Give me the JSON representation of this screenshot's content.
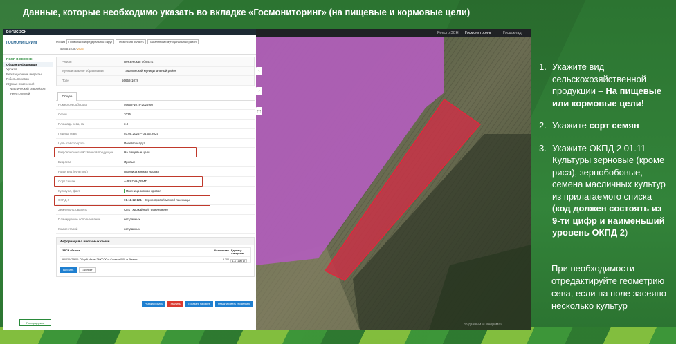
{
  "headline": "Данные, которые необходимо указать во вкладке «Госмониторинг» (на пищевые и кормовые цели)",
  "app": {
    "topbar_title": "ЕФГИС ЗСН",
    "logo": "ГОСМОНИТОРИНГ",
    "crumbs_line1": {
      "country": "Россия",
      "district": "Приволжский федеральный округ",
      "region": "Пензенская область",
      "municipality": "Тамалинский муниципальный район"
    },
    "crumbs_line2": {
      "field": "56658-1078",
      "separator": "/",
      "year": "2025"
    },
    "sidebar": {
      "section": "ПОЛЯ В СЕЗОНЕ",
      "items": [
        "Общая информация",
        "Урожай",
        "Вегетационные индексы",
        "Гибель посевов",
        "Журнал изменений",
        "Фактический севооборот",
        "Реестр полей"
      ],
      "bottom_button": "Господдержка"
    },
    "region_panel": [
      {
        "k": "Регион",
        "v": "Пензенская область"
      },
      {
        "k": "Муниципальное образование",
        "v": "Тамалинский муниципальный район"
      },
      {
        "k": "Поле",
        "v": "56658-1078"
      }
    ],
    "tab": "Общее",
    "fields": [
      {
        "k": "Номер севооборота",
        "v": "56658-1078-2025-60"
      },
      {
        "k": "Сезон",
        "v": "2025"
      },
      {
        "k": "Площадь сева, га",
        "v": "3.9"
      },
      {
        "k": "Период сева",
        "v": "03.05.2025 – 04.05.2025"
      },
      {
        "k": "Цель севооборота",
        "v": "Посев/посадка"
      },
      {
        "k": "Вид сельскохозяйственной продукции",
        "v": "На пищевые цели"
      },
      {
        "k": "Вид сева",
        "v": "Яровые"
      },
      {
        "k": "Род и вид (культура)",
        "v": "Пшеница мягкая яровая"
      },
      {
        "k": "Сорт семян",
        "v": "АЛЕКСАНДРИТ"
      },
      {
        "k": "Культура, факт",
        "v": "Пшеница мягкая яровая"
      },
      {
        "k": "ОКПД 2",
        "v": "01.11.12.121 - Зерно яровой мягкой пшеницы"
      },
      {
        "k": "Землепользователь",
        "v": "СПК \"Урожайный\" 9999999990"
      },
      {
        "k": "Планируемое использование",
        "v": "нет данных"
      },
      {
        "k": "Комментарий",
        "v": "нет данных"
      }
    ],
    "inventory": {
      "title": "Информация о вносимых семян",
      "col1": "ЭВСИ объекта",
      "col2": "Количество",
      "col3": "Единица измерения",
      "row": [
        "96/010473600: Общий объем 24000.00 кг Сочетан 0.00 кг Ячмень",
        "5 300",
        "кг"
      ],
      "pager": "1-1 (1 из 1)",
      "btn_add": "Выбрать",
      "btn_export": "Экспорт"
    },
    "actions": [
      "Редактировать",
      "Удалить",
      "Показать на карте",
      "Редактировать геометрию"
    ]
  },
  "map": {
    "tabs": [
      "Реестр ЗСН",
      "Госмониторинг",
      "Госдоклад"
    ],
    "active_tab": "Госмониторинг",
    "tools": [
      "‹",
      "›",
      "⬚"
    ],
    "caption": "по данным «Панорама»"
  },
  "steps": [
    {
      "num": "1.",
      "pre": "Укажите вид сельскохозяйственной продукции – ",
      "bold": "На пищевые или кормовые цели!",
      "post": ""
    },
    {
      "num": "2.",
      "pre": "Укажите ",
      "bold": "сорт семян",
      "post": ""
    },
    {
      "num": "3.",
      "pre": "Укажите ОКПД 2 01.11 Культуры зерновые (кроме риса), зернобобовые, семена масличных культур из прилагаемого списка ",
      "bold": "(код должен состоять из 9-ти цифр и наименьший уровень ОКПД 2",
      "post": ")"
    }
  ],
  "note": "При необходимости отредактируйте геометрию сева, если на поле засеяно несколько культур"
}
